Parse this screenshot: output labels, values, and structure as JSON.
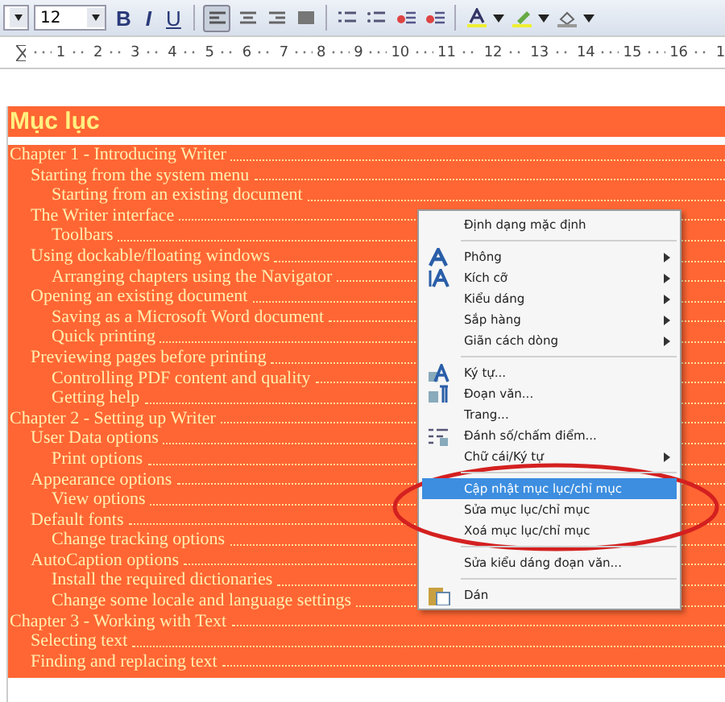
{
  "toolbar": {
    "font_size": "12",
    "buttons": [
      {
        "label": "B",
        "kind": "bold"
      },
      {
        "label": "I",
        "kind": "italic"
      },
      {
        "label": "U",
        "kind": "underline"
      }
    ],
    "align_left_selected": true
  },
  "ruler": {
    "ticks": [
      "1",
      "2",
      "3",
      "4",
      "5",
      "6",
      "7",
      "8",
      "9",
      "10",
      "11",
      "12",
      "13",
      "14",
      "15",
      "16",
      "1"
    ]
  },
  "document": {
    "heading": "Mục lục",
    "entries": [
      {
        "text": "Chapter 1 - Introducing Writer",
        "children": [
          {
            "text": "Starting from the system menu",
            "children": [
              {
                "text": "Starting from an existing document"
              }
            ]
          },
          {
            "text": "The Writer interface",
            "children": [
              {
                "text": "Toolbars"
              }
            ]
          },
          {
            "text": "Using dockable/floating windows",
            "children": [
              {
                "text": "Arranging chapters using the Navigator"
              }
            ]
          },
          {
            "text": "Opening an existing document",
            "children": [
              {
                "text": "Saving as a Microsoft Word document"
              },
              {
                "text": "Quick printing"
              }
            ]
          },
          {
            "text": "Previewing pages before printing",
            "children": [
              {
                "text": "Controlling PDF content and quality"
              },
              {
                "text": "Getting help"
              }
            ]
          }
        ]
      },
      {
        "text": "Chapter 2 - Setting up Writer",
        "children": [
          {
            "text": "User Data options",
            "children": [
              {
                "text": "Print options"
              }
            ]
          },
          {
            "text": "Appearance options",
            "children": [
              {
                "text": "View options"
              }
            ]
          },
          {
            "text": "Default fonts",
            "children": [
              {
                "text": "Change tracking options"
              }
            ]
          },
          {
            "text": "AutoCaption options",
            "children": [
              {
                "text": "Install the required dictionaries"
              },
              {
                "text": "Change some locale and language settings"
              }
            ]
          }
        ]
      },
      {
        "text": "Chapter 3 - Working with Text",
        "children": [
          {
            "text": "Selecting text"
          },
          {
            "text": "Finding and replacing text"
          }
        ]
      }
    ]
  },
  "context_menu": {
    "items": [
      {
        "kind": "item",
        "label": "Định dạng mặc định",
        "submenu": false,
        "selected": false
      },
      {
        "kind": "separator"
      },
      {
        "kind": "item",
        "label": "Phông",
        "submenu": true,
        "selected": false
      },
      {
        "kind": "item",
        "label": "Kích cỡ",
        "submenu": true,
        "selected": false
      },
      {
        "kind": "item",
        "label": "Kiểu dáng",
        "submenu": true,
        "selected": false
      },
      {
        "kind": "item",
        "label": "Sắp hàng",
        "submenu": true,
        "selected": false
      },
      {
        "kind": "item",
        "label": "Giãn cách dòng",
        "submenu": true,
        "selected": false
      },
      {
        "kind": "separator"
      },
      {
        "kind": "item",
        "label": "Ký tự...",
        "submenu": false,
        "selected": false
      },
      {
        "kind": "item",
        "label": "Đoạn văn...",
        "submenu": false,
        "selected": false
      },
      {
        "kind": "item",
        "label": "Trang...",
        "submenu": false,
        "selected": false
      },
      {
        "kind": "item",
        "label": "Đánh số/chấm điểm...",
        "submenu": false,
        "selected": false
      },
      {
        "kind": "item",
        "label": "Chữ cái/Ký tự",
        "submenu": true,
        "selected": false
      },
      {
        "kind": "separator"
      },
      {
        "kind": "item",
        "label": "Cập nhật mục lục/chỉ mục",
        "submenu": false,
        "selected": true
      },
      {
        "kind": "item",
        "label": "Sửa mục lục/chỉ mục",
        "submenu": false,
        "selected": false
      },
      {
        "kind": "item",
        "label": "Xoá mục lục/chỉ mục",
        "submenu": false,
        "selected": false
      },
      {
        "kind": "separator"
      },
      {
        "kind": "item",
        "label": "Sửa kiểu dáng đoạn văn...",
        "submenu": false,
        "selected": false
      },
      {
        "kind": "separator"
      },
      {
        "kind": "item",
        "label": "Dán",
        "submenu": false,
        "selected": false
      }
    ]
  }
}
